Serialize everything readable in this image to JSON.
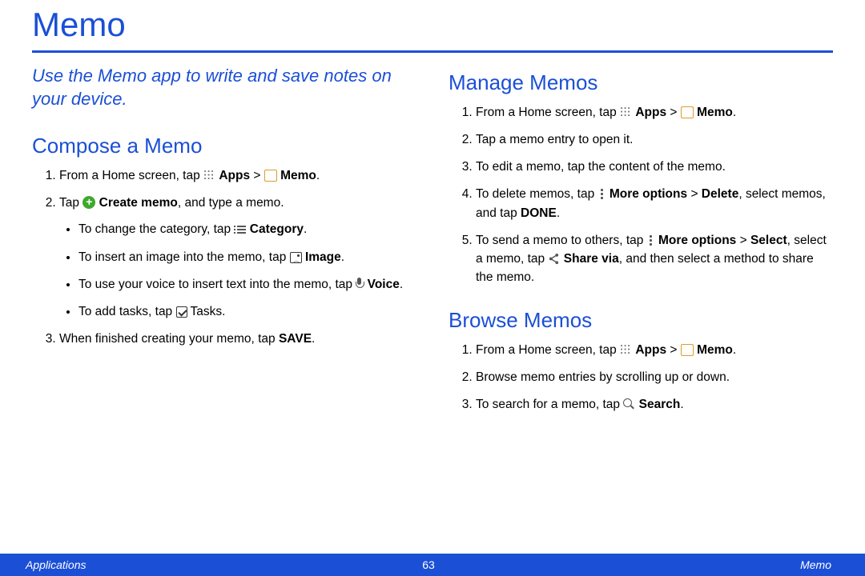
{
  "title": "Memo",
  "intro": "Use the Memo app to write and save notes on your device.",
  "compose": {
    "heading": "Compose a Memo",
    "step1_a": "From a Home screen, tap ",
    "apps_label": "Apps",
    "gt": " > ",
    "memo_label": "Memo",
    "period": ".",
    "step2_a": "Tap ",
    "create_memo": "Create memo",
    "step2_b": ", and type a memo.",
    "bullet_cat_a": "To change the category, tap ",
    "cat_label": "Category",
    "bullet_img_a": "To insert an image into the memo, tap ",
    "img_label": "Image",
    "bullet_voice_a": "To use your voice to insert text into the memo, tap ",
    "voice_label": "Voice",
    "bullet_task_a": "To add tasks, tap ",
    "task_label": "Tasks.",
    "step3_a": "When finished creating your memo, tap ",
    "save_label": "SAVE"
  },
  "manage": {
    "heading": "Manage Memos",
    "step2": "Tap a memo entry to open it.",
    "step3": "To edit a memo, tap the content of the memo.",
    "step4_a": "To delete memos, tap ",
    "more_opts": "More options",
    "delete_label": "Delete",
    "step4_b": ", select memos, and tap ",
    "done_label": "DONE",
    "step5_a": "To send a memo to others, tap ",
    "select_label": "Select",
    "step5_b": ", select a memo, tap ",
    "share_label": "Share via",
    "step5_c": ", and then select a method to share the memo."
  },
  "browse": {
    "heading": "Browse Memos",
    "step2": "Browse memo entries by scrolling up or down.",
    "step3_a": "To search for a memo, tap ",
    "search_label": "Search"
  },
  "footer": {
    "left": "Applications",
    "center": "63",
    "right": "Memo"
  }
}
